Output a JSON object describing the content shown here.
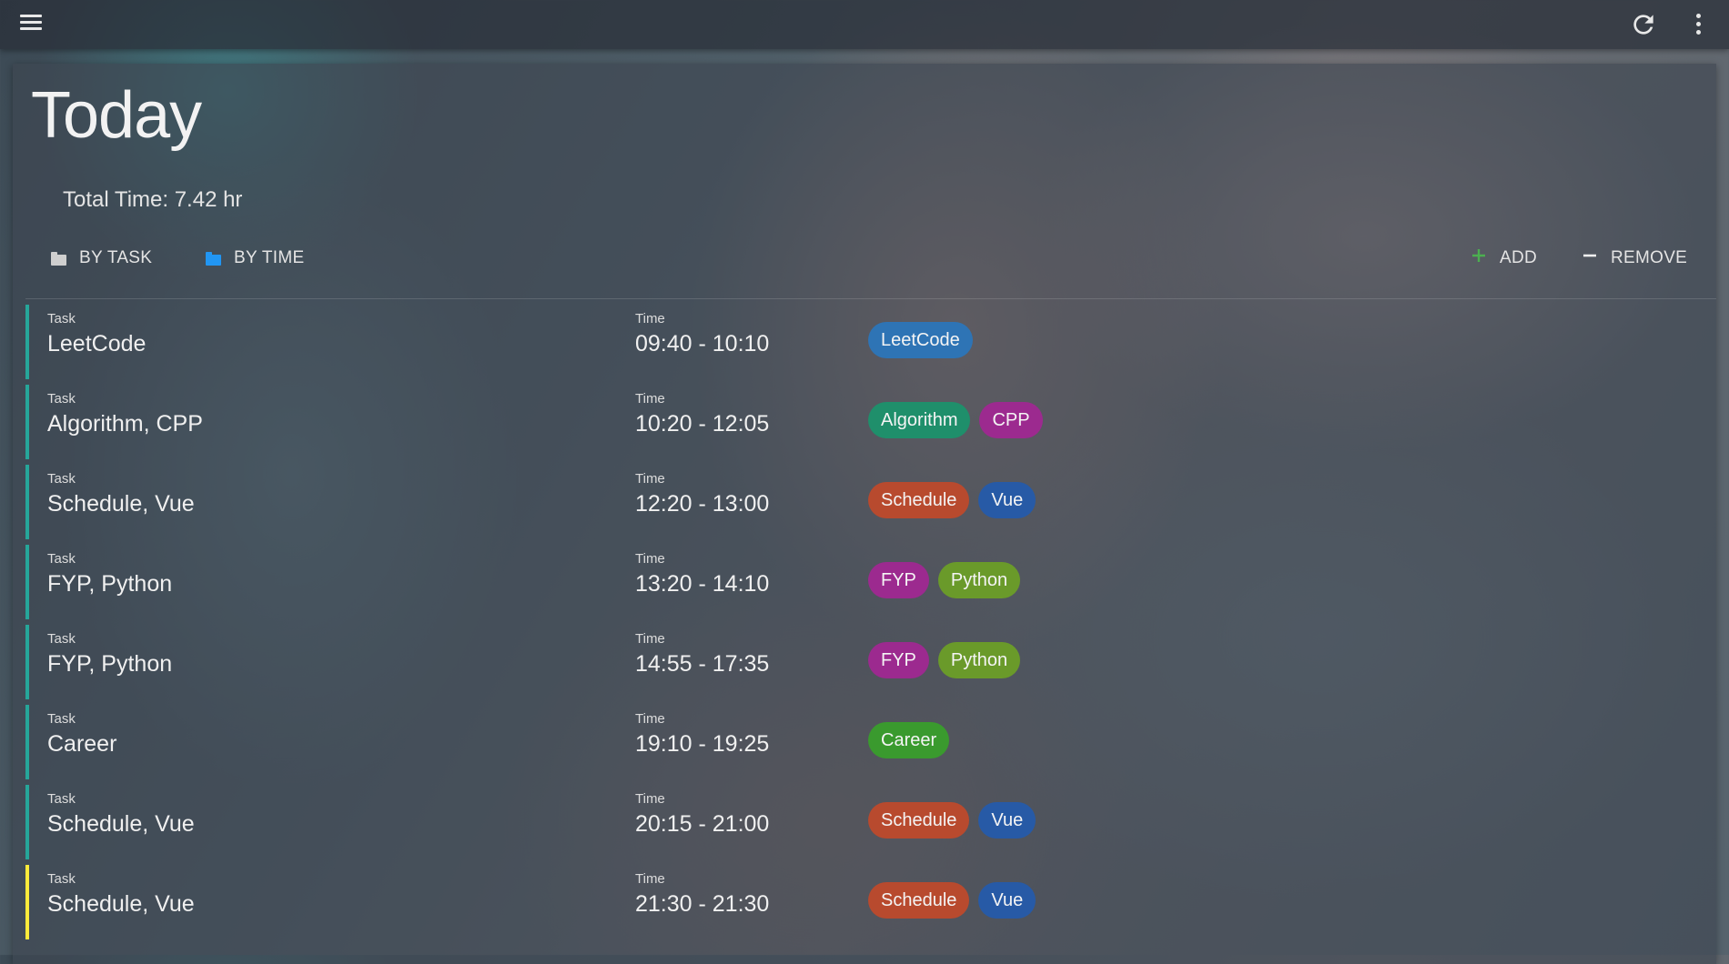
{
  "colors": {
    "accent_teal": "#26a69a",
    "accent_yellow": "#ffeb3b",
    "folder_grey": "#cfcfcf",
    "folder_blue": "#2196f3",
    "add_green": "#4caf50",
    "tags": {
      "LeetCode": "#2e74b5",
      "Algorithm": "#1f8f6b",
      "CPP": "#9c2a8f",
      "Schedule": "#b84a2e",
      "Vue": "#275aa6",
      "FYP": "#9c2a8f",
      "Python": "#6a9a2a",
      "Career": "#3a9a2e"
    }
  },
  "header": {
    "menu_icon": "menu-icon",
    "refresh_icon": "refresh-icon",
    "more_icon": "more-vert-icon"
  },
  "main": {
    "title": "Today",
    "total_time": "Total Time: 7.42 hr",
    "toolbar": {
      "by_task": "BY TASK",
      "by_time": "BY TIME",
      "add": "ADD",
      "remove": "REMOVE"
    },
    "entries": [
      {
        "task_label": "Task",
        "task": "LeetCode",
        "time_label": "Time",
        "time": "09:40 - 10:10",
        "tags": [
          "LeetCode"
        ],
        "bar": "teal"
      },
      {
        "task_label": "Task",
        "task": "Algorithm, CPP",
        "time_label": "Time",
        "time": "10:20 - 12:05",
        "tags": [
          "Algorithm",
          "CPP"
        ],
        "bar": "teal"
      },
      {
        "task_label": "Task",
        "task": "Schedule, Vue",
        "time_label": "Time",
        "time": "12:20 - 13:00",
        "tags": [
          "Schedule",
          "Vue"
        ],
        "bar": "teal"
      },
      {
        "task_label": "Task",
        "task": "FYP, Python",
        "time_label": "Time",
        "time": "13:20 - 14:10",
        "tags": [
          "FYP",
          "Python"
        ],
        "bar": "teal"
      },
      {
        "task_label": "Task",
        "task": "FYP, Python",
        "time_label": "Time",
        "time": "14:55 - 17:35",
        "tags": [
          "FYP",
          "Python"
        ],
        "bar": "teal"
      },
      {
        "task_label": "Task",
        "task": "Career",
        "time_label": "Time",
        "time": "19:10 - 19:25",
        "tags": [
          "Career"
        ],
        "bar": "teal"
      },
      {
        "task_label": "Task",
        "task": "Schedule, Vue",
        "time_label": "Time",
        "time": "20:15 - 21:00",
        "tags": [
          "Schedule",
          "Vue"
        ],
        "bar": "teal"
      },
      {
        "task_label": "Task",
        "task": "Schedule, Vue",
        "time_label": "Time",
        "time": "21:30 - 21:30",
        "tags": [
          "Schedule",
          "Vue"
        ],
        "bar": "yellow"
      }
    ]
  }
}
